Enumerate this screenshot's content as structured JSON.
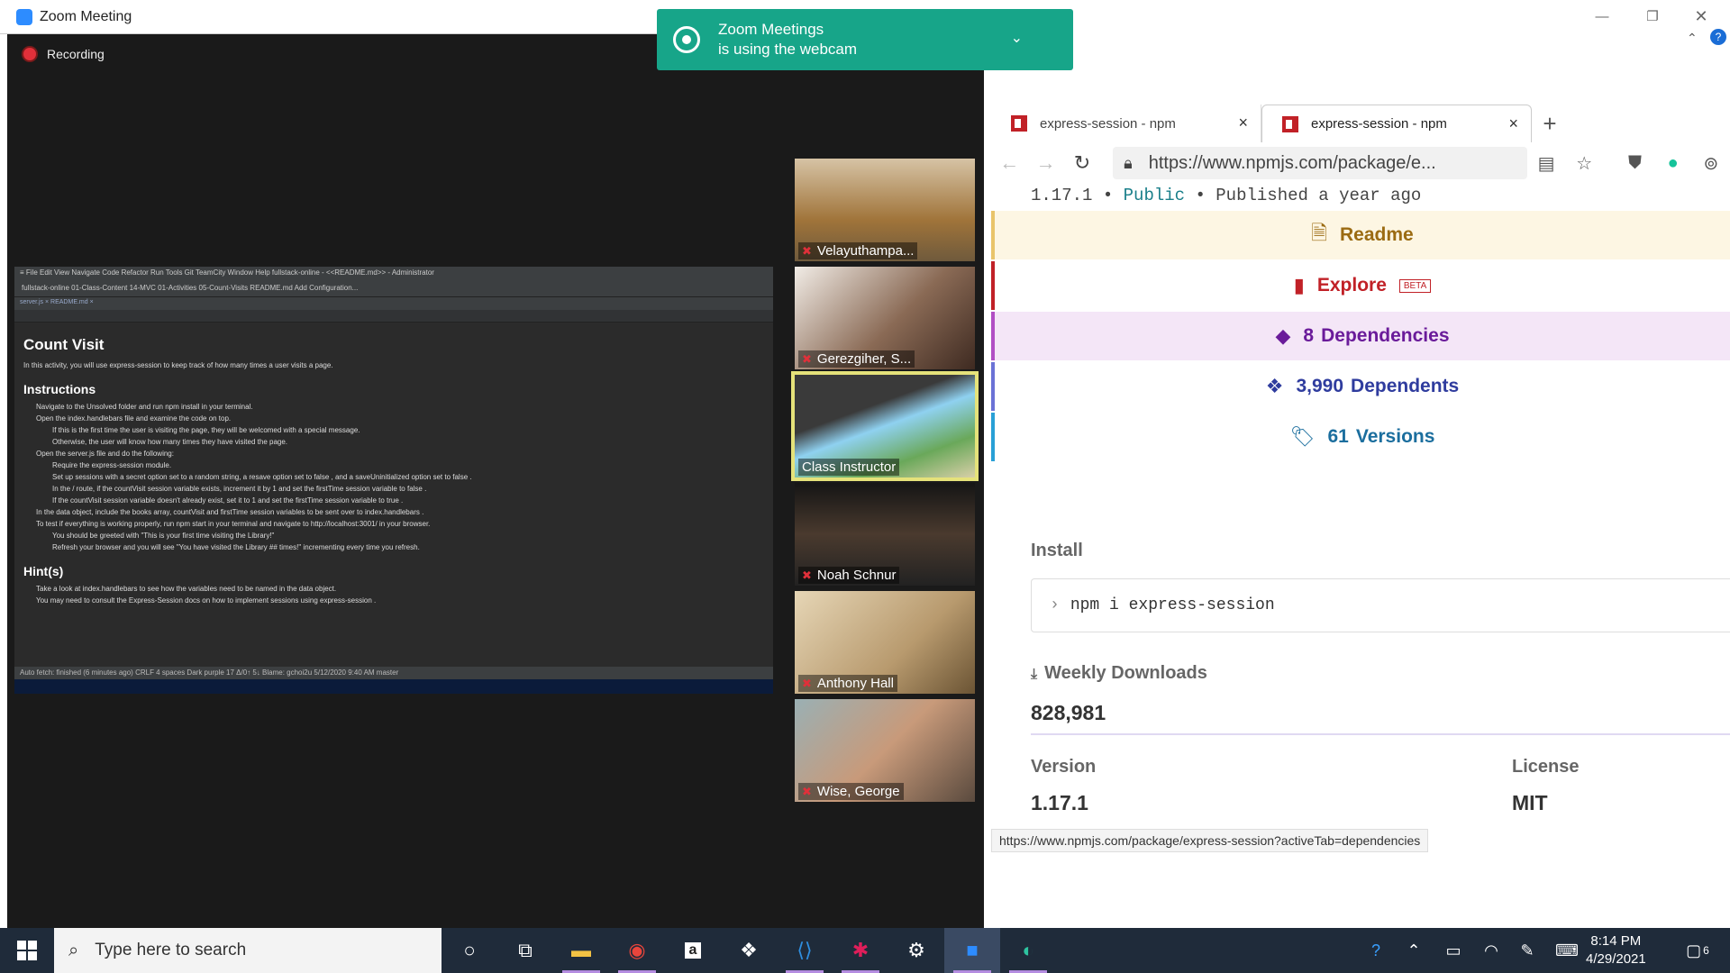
{
  "zoom": {
    "title": "Zoom Meeting",
    "recording": "Recording"
  },
  "notification": {
    "line1": "Zoom Meetings",
    "line2": "is using the webcam"
  },
  "share": {
    "menu": "≡ File Edit View Navigate Code Refactor Run Tools Git TeamCity Window Help     fullstack-online - <<README.md>> - Administrator",
    "crumbs": "fullstack-online  01-Class-Content  14-MVC  01-Activities  05-Count-Visits  README.md     Add Configuration...",
    "ftabs": "server.js ×   README.md ×",
    "title": "Count Visit",
    "intro": "In this activity, you will use express-session to keep track of how many times a user visits a page.",
    "instructions_h": "Instructions",
    "items": [
      {
        "t": "Navigate to the Unsolved folder and run npm install in your terminal.",
        "l": 1
      },
      {
        "t": "Open the index.handlebars file and examine the code on top.",
        "l": 1
      },
      {
        "t": "If this is the first time the user is visiting the page, they will be welcomed with a special message.",
        "l": 2
      },
      {
        "t": "Otherwise, the user will know how many times they have visited the page.",
        "l": 2
      },
      {
        "t": "Open the server.js file and do the following:",
        "l": 1
      },
      {
        "t": "Require the express-session module.",
        "l": 2
      },
      {
        "t": "Set up sessions with a secret option set to a random string, a resave option set to false , and a saveUninitialized option set to false .",
        "l": 2
      },
      {
        "t": "In the / route, if the countVisit session variable exists, increment it by 1 and set the firstTime session variable to false .",
        "l": 2
      },
      {
        "t": "If the countVisit session variable doesn't already exist, set it to 1 and set the firstTime session variable to true .",
        "l": 2
      },
      {
        "t": "In the data object, include the books array, countVisit and firstTime session variables to be sent over to index.handlebars .",
        "l": 1
      },
      {
        "t": "To test if everything is working properly, run npm start in your terminal and navigate to http://localhost:3001/ in your browser.",
        "l": 1
      },
      {
        "t": "You should be greeted with \"This is your first time visiting the Library!\"",
        "l": 2
      },
      {
        "t": "Refresh your browser and you will see \"You have visited the Library ## times!\" incrementing every time you refresh.",
        "l": 2
      }
    ],
    "hints_h": "Hint(s)",
    "hints": [
      "Take a look at index.handlebars to see how the variables need to be named in the data object.",
      "You may need to consult the Express-Session docs on how to implement sessions using express-session ."
    ],
    "status": "Auto fetch: finished (6 minutes ago)                                                         CRLF  4 spaces  Dark purple  17 Δ/0↑ 5↓  Blame: gchoi2u 5/12/2020 9:40 AM  master"
  },
  "participants": [
    "Velayuthampa...",
    "Gerezgiher, S...",
    "Class Instructor",
    "Noah Schnur",
    "Anthony Hall",
    "Wise, George"
  ],
  "browser": {
    "tabs": [
      {
        "label": "express-session - npm"
      },
      {
        "label": "express-session - npm"
      }
    ],
    "url": "https://www.npmjs.com/package/e...",
    "status_url": "https://www.npmjs.com/package/express-session?activeTab=dependencies"
  },
  "npm": {
    "version_line": "1.17.1",
    "public": "Public",
    "published": "Published a year ago",
    "readme": "Readme",
    "explore": "Explore",
    "beta": "BETA",
    "deps_count": "8",
    "deps": "Dependencies",
    "dependents_count": "3,990",
    "dependents": "Dependents",
    "versions_count": "61",
    "versions": "Versions",
    "install_label": "Install",
    "install_cmd": "npm i express-session",
    "weekly_label": "Weekly Downloads",
    "weekly": "828,981",
    "version_label": "Version",
    "version": "1.17.1",
    "license_label": "License",
    "license": "MIT"
  },
  "taskbar": {
    "search": "Type here to search",
    "time": "8:14 PM",
    "date": "4/29/2021",
    "notif_count": "6"
  },
  "colors": {
    "npm_red": "#c12127",
    "readme_bg": "#fdf6e3",
    "deps_bg": "#f4e6f7",
    "zoom_green": "#17a589",
    "taskbar": "#1f2b3a"
  }
}
